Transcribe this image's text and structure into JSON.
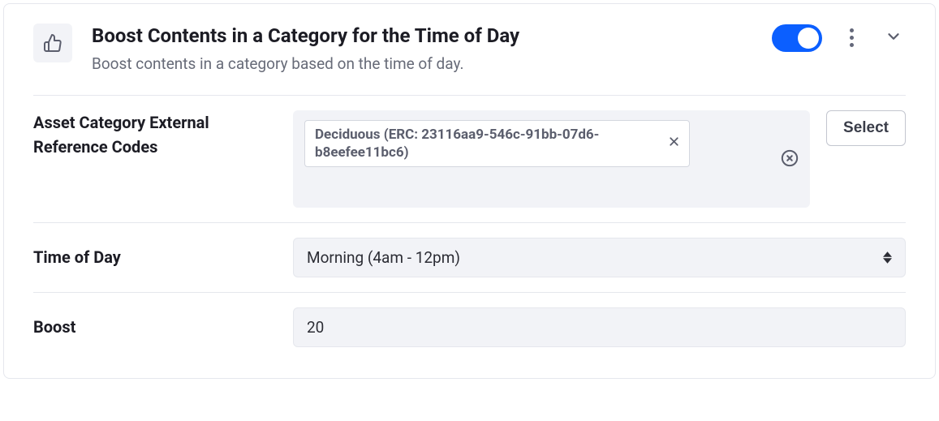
{
  "header": {
    "title": "Boost Contents in a Category for the Time of Day",
    "subtitle": "Boost contents in a category based on the time of day.",
    "toggle_on": true
  },
  "fields": {
    "asset_category": {
      "label": "Asset Category External Reference Codes",
      "tag": "Deciduous (ERC: 23116aa9-546c-91bb-07d6-b8eefee11bc6)",
      "select_button": "Select"
    },
    "time_of_day": {
      "label": "Time of Day",
      "value": "Morning (4am - 12pm)"
    },
    "boost": {
      "label": "Boost",
      "value": "20"
    }
  }
}
